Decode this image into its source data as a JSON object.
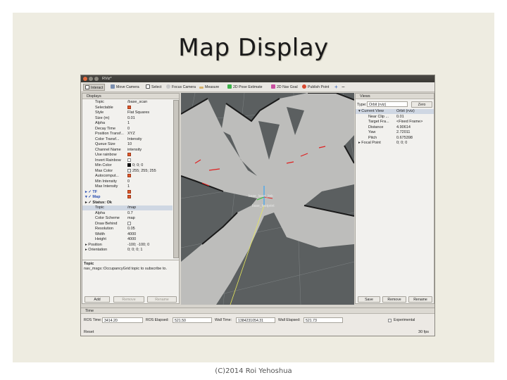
{
  "slide": {
    "title": "Map Display",
    "footer": "(C)2014 Roi Yehoshua"
  },
  "window": {
    "title": "RViz*"
  },
  "toolbar": {
    "items": [
      {
        "label": "Interact",
        "icon": "cursor-icon"
      },
      {
        "label": "Move Camera",
        "icon": "move-camera-icon"
      },
      {
        "label": "Select",
        "icon": "select-icon"
      },
      {
        "label": "Focus Camera",
        "icon": "focus-icon"
      },
      {
        "label": "Measure",
        "icon": "ruler-icon"
      },
      {
        "label": "2D Pose Estimate",
        "icon": "arrow-green-icon"
      },
      {
        "label": "2D Nav Goal",
        "icon": "arrow-pink-icon"
      },
      {
        "label": "Publish Point",
        "icon": "pin-icon"
      },
      {
        "label": "+",
        "icon": "plus-icon"
      },
      {
        "label": "−",
        "icon": "minus-icon"
      }
    ]
  },
  "displays": {
    "header": "Displays",
    "rows": [
      {
        "key": "Topic",
        "value": "/base_scan"
      },
      {
        "key": "Selectable",
        "check": true
      },
      {
        "key": "Style",
        "value": "Flat Squares"
      },
      {
        "key": "Size (m)",
        "value": "0.01"
      },
      {
        "key": "Alpha",
        "value": "1"
      },
      {
        "key": "Decay Time",
        "value": "0"
      },
      {
        "key": "Position Transf...",
        "value": "XYZ"
      },
      {
        "key": "Color Transf...",
        "value": "Intensity"
      },
      {
        "key": "Queue Size",
        "value": "10"
      },
      {
        "key": "Channel Name",
        "value": "intensity"
      },
      {
        "key": "Use rainbow",
        "check": true
      },
      {
        "key": "Invert Rainbow",
        "check": false
      },
      {
        "key": "Min Color",
        "value": "0; 0; 0",
        "swatch": "black"
      },
      {
        "key": "Max Color",
        "value": "255; 255; 255",
        "swatch": "white"
      },
      {
        "key": "Autocomput...",
        "check": true
      },
      {
        "key": "Min Intensity",
        "value": "0"
      },
      {
        "key": "Max Intensity",
        "value": "1"
      },
      {
        "key": "▸ ✓ TF",
        "check": true,
        "blue": true
      },
      {
        "key": "▾ ✓ Map",
        "check": true,
        "blue": true
      },
      {
        "key": "   ▸ ✓ Status: Ok",
        "bold": true
      },
      {
        "key": "Topic",
        "value": "/map",
        "selected": true
      },
      {
        "key": "Alpha",
        "value": "0.7"
      },
      {
        "key": "Color Scheme",
        "value": "map"
      },
      {
        "key": "Draw Behind",
        "check": false
      },
      {
        "key": "Resolution",
        "value": "0.05"
      },
      {
        "key": "Width",
        "value": "4000"
      },
      {
        "key": "Height",
        "value": "4000"
      },
      {
        "key": "▸ Position",
        "value": "-100; -100; 0"
      },
      {
        "key": "▸ Orientation",
        "value": "0; 0; 0; 1"
      }
    ],
    "desc_title": "Topic",
    "desc_text": "nav_msgs::OccupancyGrid topic to subscribe to.",
    "buttons": [
      "Add",
      "Remove",
      "Rename"
    ]
  },
  "views": {
    "header": "Views",
    "type_label": "Type:",
    "type_value": "Orbit (rviz)",
    "zero_label": "Zero",
    "rows": [
      {
        "key": "▾ Current View",
        "value": "Orbit (rviz)",
        "selected": true
      },
      {
        "key": "Near Clip ...",
        "value": "0.01"
      },
      {
        "key": "Target Fra...",
        "value": "<Fixed Frame>"
      },
      {
        "key": "Distance",
        "value": "4.90614"
      },
      {
        "key": "Yaw",
        "value": "2.72011"
      },
      {
        "key": "Pitch",
        "value": "0.675398"
      },
      {
        "key": "▸ Focal Point",
        "value": "0; 0; 0"
      }
    ],
    "buttons": [
      "Save",
      "Remove",
      "Rename"
    ]
  },
  "viewport": {
    "labels": [
      "base_laser_link",
      "base_footprint"
    ]
  },
  "time": {
    "header": "Time",
    "ros_time_label": "ROS Time:",
    "ros_time": "3414.20",
    "ros_elapsed_label": "ROS Elapsed:",
    "ros_elapsed": "521.50",
    "wall_time_label": "Wall Time:",
    "wall_time": "1384231054.31",
    "wall_elapsed_label": "Wall Elapsed:",
    "wall_elapsed": "521.73",
    "experimental_label": "Experimental",
    "reset_label": "Reset",
    "fps": "30 fps"
  }
}
